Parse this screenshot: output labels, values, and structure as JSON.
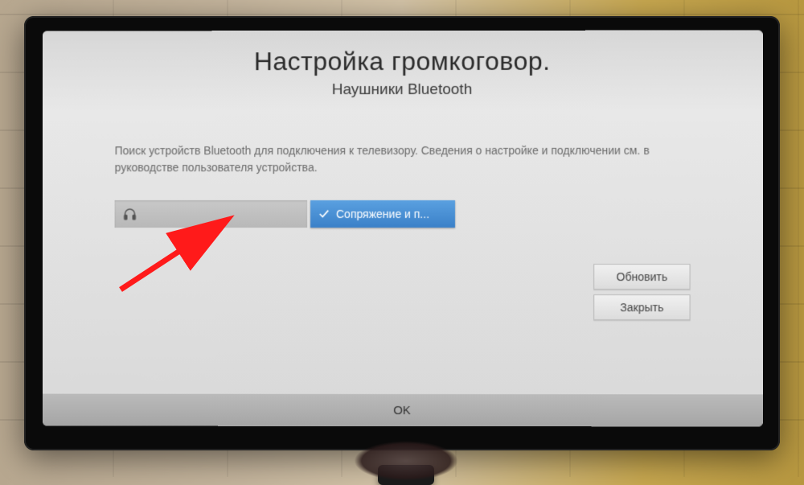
{
  "title": "Настройка громкоговор.",
  "subtitle": "Наушники Bluetooth",
  "description": "Поиск устройств Bluetooth для подключения к телевизору. Сведения о настройке и подключении см. в руководстве пользователя устройства.",
  "device": {
    "name": " "
  },
  "pair_button": "Сопряжение и п...",
  "buttons": {
    "refresh": "Обновить",
    "close": "Закрыть",
    "ok": "OK"
  }
}
